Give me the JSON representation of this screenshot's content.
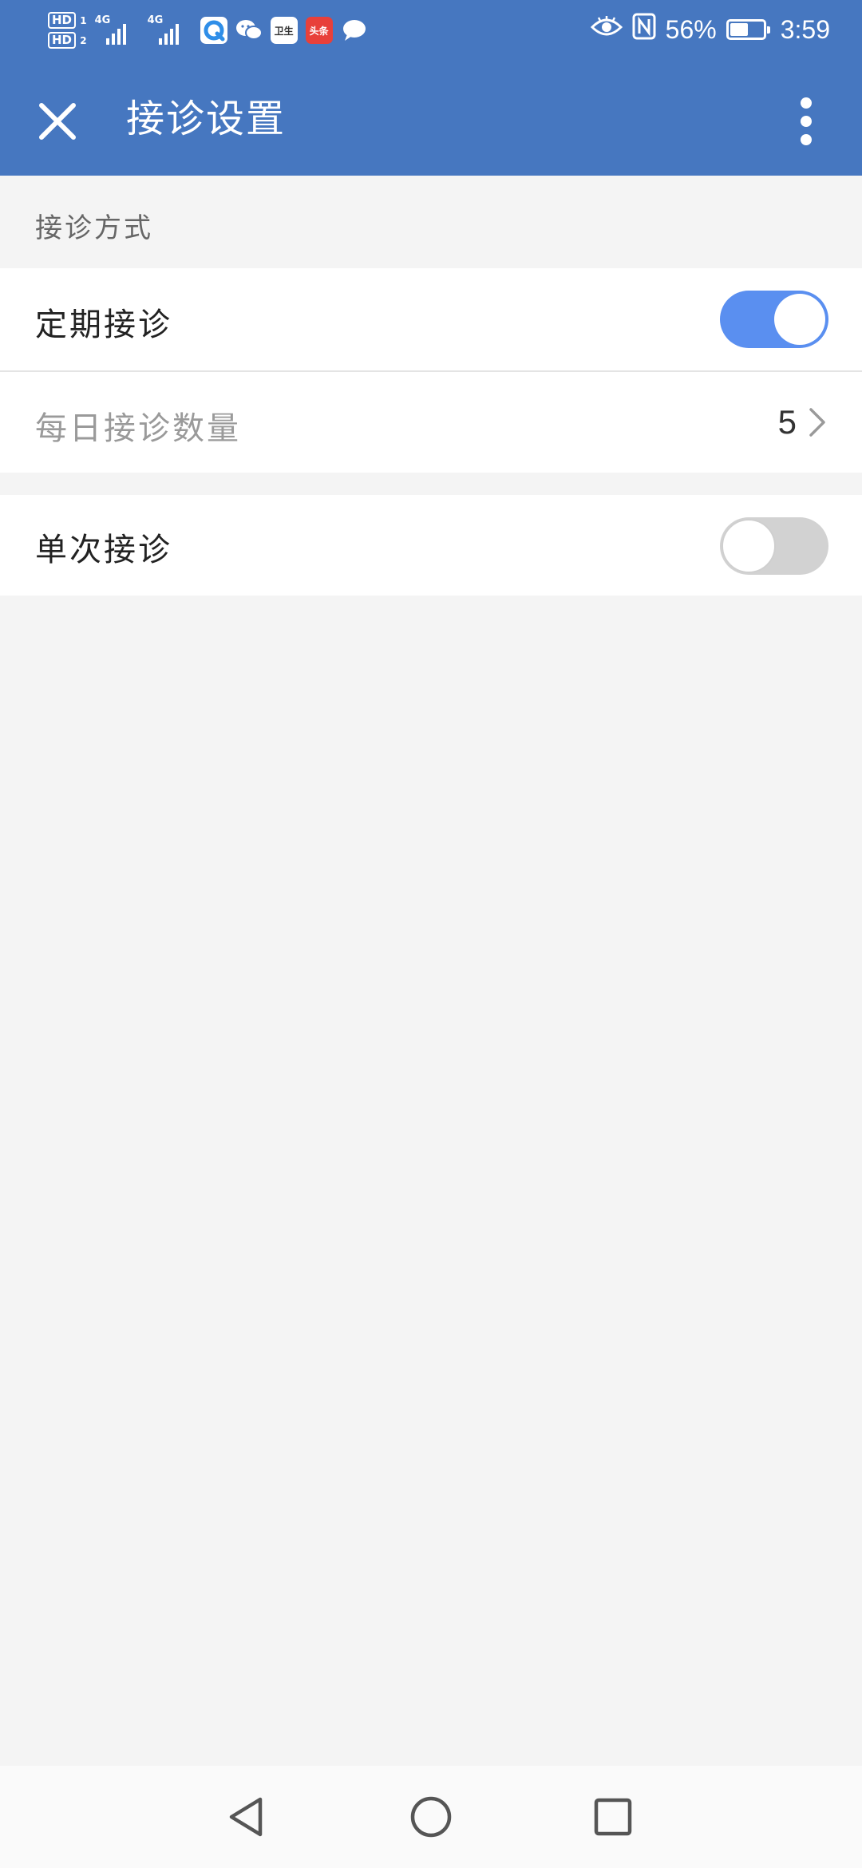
{
  "status_bar": {
    "hd1": "HD",
    "hd1_sim": "1",
    "hd2": "HD",
    "hd2_sim": "2",
    "network1": "4G",
    "network2": "4G",
    "battery_percent": "56%",
    "battery_level": 0.56,
    "time": "3:59",
    "icons": [
      "eye-icon",
      "nfc-icon",
      "battery-icon"
    ],
    "notification_icons": [
      "qq-browser-icon",
      "wechat-icon",
      "app-icon",
      "toutiao-icon",
      "message-icon"
    ],
    "app_icon_text": "卫生",
    "toutiao_text": "头条"
  },
  "app_bar": {
    "close_icon": "close-icon",
    "title": "接诊设置",
    "more_icon": "more-vertical-icon",
    "background": "#4677c0"
  },
  "section": {
    "header": "接诊方式"
  },
  "rows": {
    "scheduled": {
      "label": "定期接诊",
      "toggle_on": true
    },
    "daily_count": {
      "label": "每日接诊数量",
      "value": "5"
    },
    "single": {
      "label": "单次接诊",
      "toggle_on": false
    }
  },
  "colors": {
    "accent": "#5a8ff0",
    "toggle_off": "#d2d2d2",
    "background": "#f4f4f4"
  },
  "nav_bar": {
    "icons": [
      "back-icon",
      "home-icon",
      "recents-icon"
    ]
  }
}
